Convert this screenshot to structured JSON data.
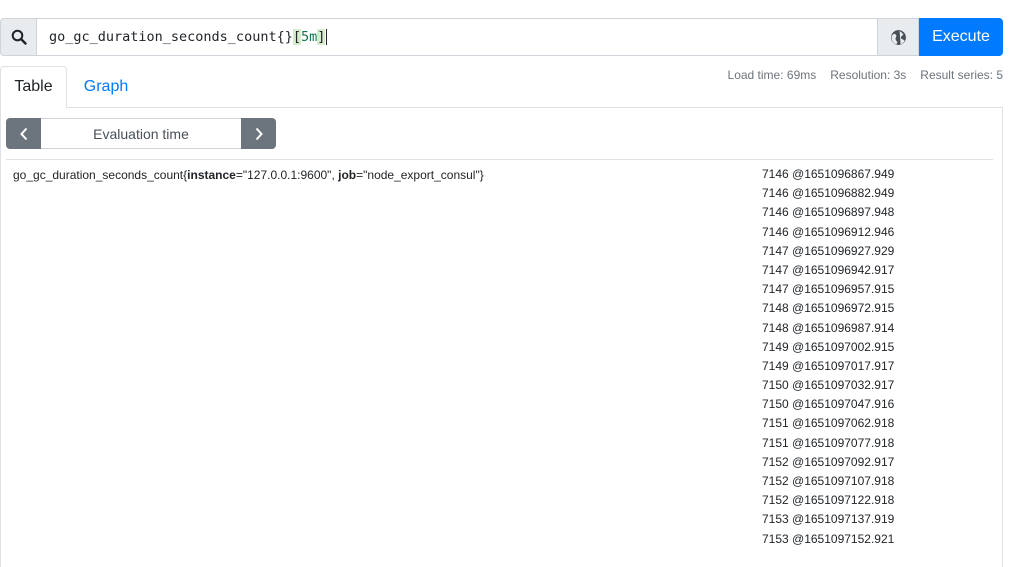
{
  "query": {
    "metric": "go_gc_duration_seconds_count{}",
    "range_open": "[",
    "range_duration": "5m",
    "range_close": "]",
    "execute_label": "Execute",
    "search_icon": "search-icon",
    "explorer_icon": "globe-icon"
  },
  "tabs": [
    {
      "label": "Table",
      "active": true
    },
    {
      "label": "Graph",
      "active": false
    }
  ],
  "stats": {
    "load_time": "Load time: 69ms",
    "resolution": "Resolution: 3s",
    "result_series": "Result series: 5"
  },
  "evaluation": {
    "prev_icon": "chevron-left-icon",
    "next_icon": "chevron-right-icon",
    "placeholder": "Evaluation time"
  },
  "result": {
    "metric_name": "go_gc_duration_seconds_count",
    "open_brace": "{",
    "label1_key": "instance",
    "label1_value": "=\"127.0.0.1:9600\", ",
    "label2_key": "job",
    "label2_value": "=\"node_export_consul\"",
    "close_brace": "}",
    "values": [
      "7146 @1651096867.949",
      "7146 @1651096882.949",
      "7146 @1651096897.948",
      "7146 @1651096912.946",
      "7147 @1651096927.929",
      "7147 @1651096942.917",
      "7147 @1651096957.915",
      "7148 @1651096972.915",
      "7148 @1651096987.914",
      "7149 @1651097002.915",
      "7149 @1651097017.917",
      "7150 @1651097032.917",
      "7150 @1651097047.916",
      "7151 @1651097062.918",
      "7151 @1651097077.918",
      "7152 @1651097092.917",
      "7152 @1651097107.918",
      "7152 @1651097122.918",
      "7153 @1651097137.919",
      "7153 @1651097152.921"
    ]
  },
  "colors": {
    "accent": "#007bff",
    "secondary": "#6c757d",
    "duration_text": "#11764c"
  }
}
